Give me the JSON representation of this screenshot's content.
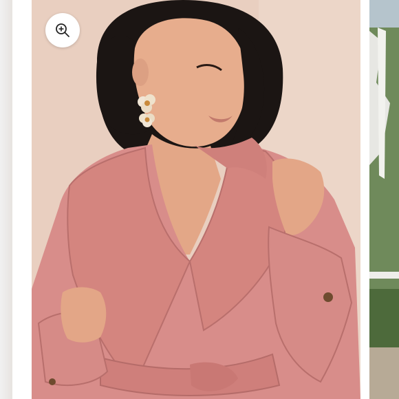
{
  "gallery": {
    "zoom_button": {
      "icon": "zoom-in-icon",
      "label": ""
    },
    "main_image": {
      "alt": "",
      "colors": {
        "backdrop": "#e8cdbd",
        "coat": "#d98f8c",
        "coat_shadow": "#b86f6d",
        "hair": "#1c1614",
        "skin": "#e8b08f"
      }
    },
    "next_image": {
      "alt": ""
    }
  }
}
